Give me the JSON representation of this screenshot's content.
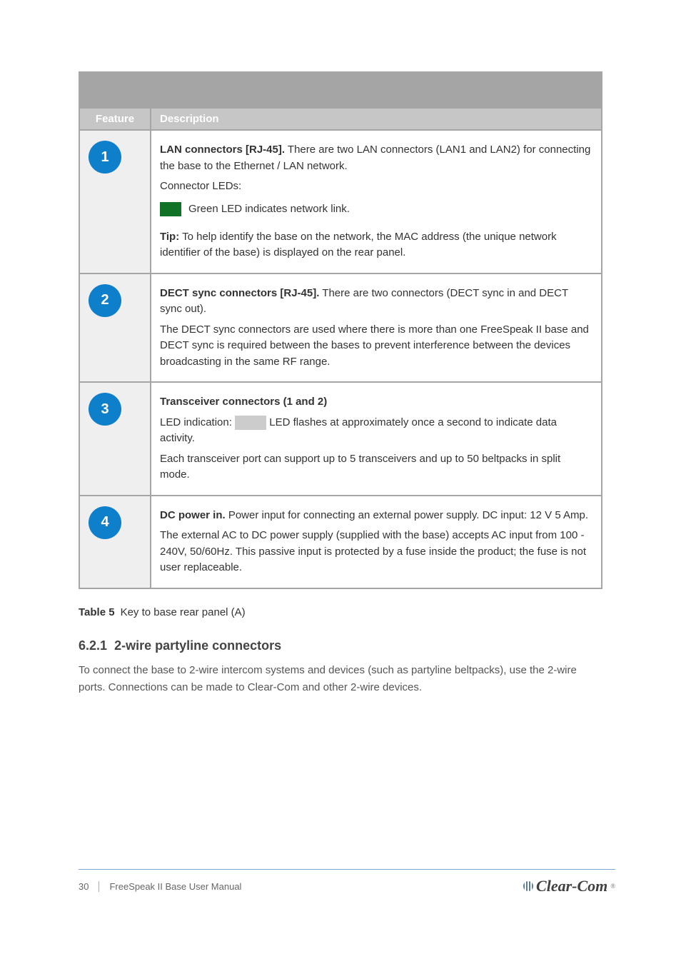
{
  "table": {
    "subheader_left": "Feature",
    "subheader_right": "Description",
    "rows": [
      {
        "num": "1",
        "title": "LAN connectors [RJ-45].",
        "p1": " There are two LAN connectors (LAN1 and LAN2) for connecting the base to the Ethernet / LAN network.",
        "led_intro": "Connector LEDs:",
        "bullet_text": "Green LED indicates network link.",
        "tip_label": "Tip:",
        "tip_text": " To help identify the base on the network, the MAC address (the unique network identifier of the base) is displayed on the rear panel."
      },
      {
        "num": "2",
        "title": "DECT sync connectors [RJ-45].",
        "p1": " There are two connectors (DECT sync in and DECT sync out).",
        "p2": "The DECT sync connectors are used where there is more than one FreeSpeak II base and DECT sync is required between the bases to prevent interference between the devices broadcasting in the same RF range."
      },
      {
        "num": "3",
        "title": "Transceiver connectors (1 and 2)",
        "p1_before": "LED indication:",
        "p1_after": " LED flashes at approximately once a second to indicate data activity.",
        "p2": "Each transceiver port can support up to 5 transceivers and up to 50 beltpacks in split mode."
      },
      {
        "num": "4",
        "title": "DC power in.",
        "p1": " Power input for connecting an external power supply. DC input: 12 V 5 Amp.",
        "p2": "The external AC to DC power supply (supplied with the base) accepts AC input from 100 - 240V, 50/60Hz. This passive input is protected by a fuse inside the product; the fuse is not user replaceable."
      }
    ]
  },
  "caption_label": "Table 5",
  "caption_text": "Key to base rear panel (A)",
  "subsection": {
    "number": "6.2.1",
    "title": "2-wire partyline connectors",
    "body": "To connect the base to 2-wire intercom systems and devices (such as partyline beltpacks), use the 2-wire ports. Connections can be made to Clear-Com and other 2-wire devices."
  },
  "footer": {
    "page": "30",
    "doc": "FreeSpeak II Base User Manual"
  },
  "logo_text": "Clear-Com"
}
